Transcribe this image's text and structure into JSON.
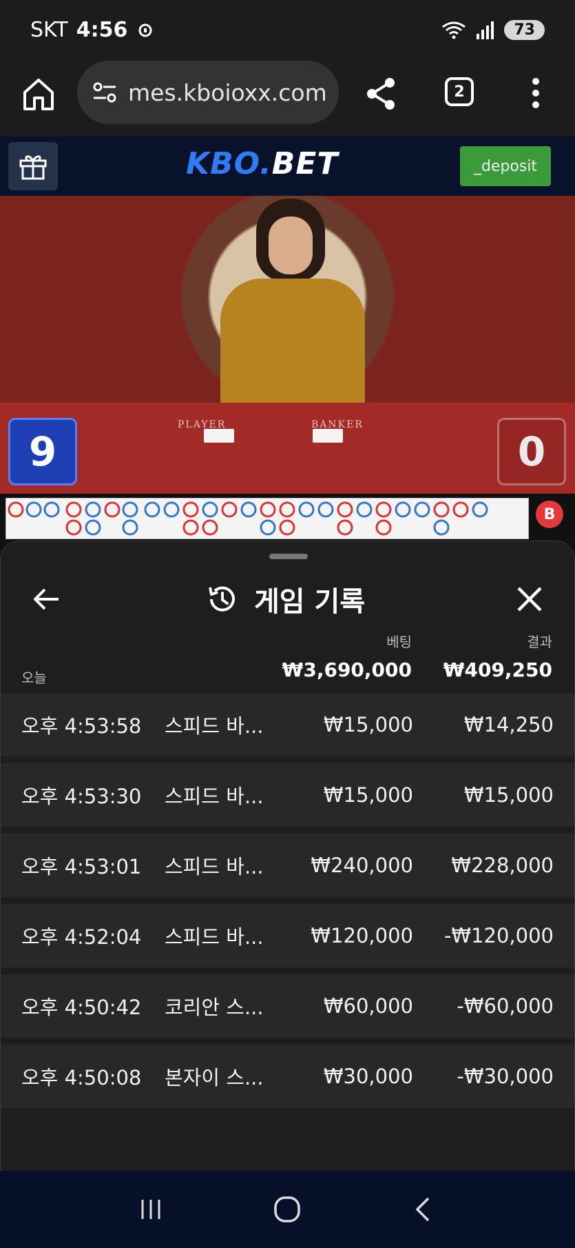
{
  "status": {
    "carrier": "SKT",
    "time": "4:56",
    "battery": "73"
  },
  "browser": {
    "url": "mes.kboioxx.com",
    "tab_count": "2"
  },
  "site": {
    "logo_part1": "KBO.",
    "logo_part2": "BET",
    "deposit_label": "_deposit"
  },
  "video": {
    "player_label": "PLAYER",
    "banker_label": "BANKER",
    "player_score": "9",
    "banker_score": "0"
  },
  "roadmap": {
    "b_label": "B"
  },
  "history": {
    "title": "게임 기록",
    "bet_header": "베팅",
    "result_header": "결과",
    "today_label": "오늘",
    "total_bet": "₩3,690,000",
    "total_result": "₩409,250",
    "rows": [
      {
        "time": "오후 4:53:58",
        "game": "스피드 바...",
        "bet": "₩15,000",
        "result": "₩14,250"
      },
      {
        "time": "오후 4:53:30",
        "game": "스피드 바...",
        "bet": "₩15,000",
        "result": "₩15,000"
      },
      {
        "time": "오후 4:53:01",
        "game": "스피드 바...",
        "bet": "₩240,000",
        "result": "₩228,000"
      },
      {
        "time": "오후 4:52:04",
        "game": "스피드 바...",
        "bet": "₩120,000",
        "result": "-₩120,000"
      },
      {
        "time": "오후 4:50:42",
        "game": "코리안 스...",
        "bet": "₩60,000",
        "result": "-₩60,000"
      },
      {
        "time": "오후 4:50:08",
        "game": "본자이 스...",
        "bet": "₩30,000",
        "result": "-₩30,000"
      }
    ]
  }
}
